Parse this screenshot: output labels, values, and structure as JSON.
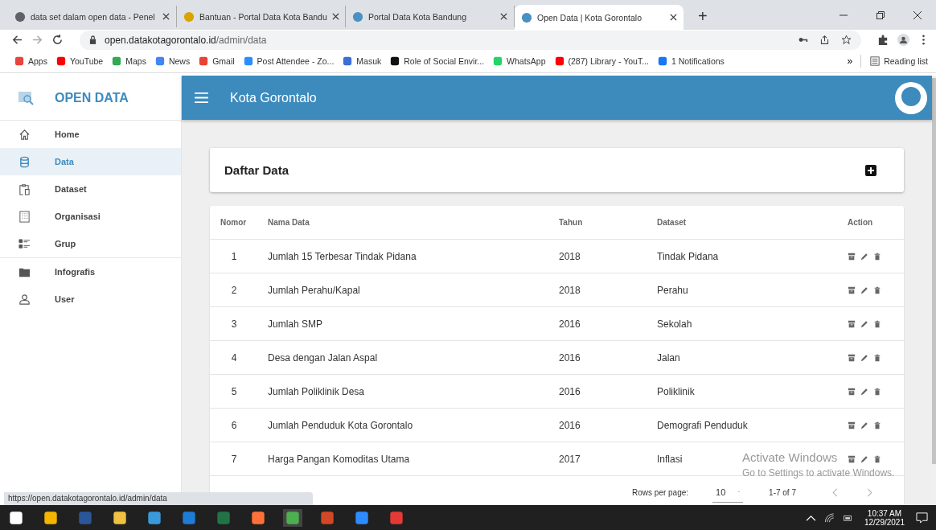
{
  "browser": {
    "tabs": [
      {
        "title": "data set dalam open data - Penel",
        "selected": false
      },
      {
        "title": "Bantuan - Portal Data Kota Bandu",
        "selected": false
      },
      {
        "title": "Portal Data Kota Bandung",
        "selected": false
      },
      {
        "title": "Open Data | Kota Gorontalo",
        "selected": true
      }
    ],
    "new_tab": "+",
    "url_host": "open.datakotagorontalo.id",
    "url_path": "/admin/data",
    "bookmarks": [
      {
        "label": "Apps"
      },
      {
        "label": "YouTube"
      },
      {
        "label": "Maps"
      },
      {
        "label": "News"
      },
      {
        "label": "Gmail"
      },
      {
        "label": "Post Attendee - Zo..."
      },
      {
        "label": "Masuk"
      },
      {
        "label": "Role of Social Envir..."
      },
      {
        "label": "WhatsApp"
      },
      {
        "label": "(287) Library - YouT..."
      },
      {
        "label": "1 Notifications"
      }
    ],
    "overflow": "»",
    "reading_list": "Reading list"
  },
  "sidebar": {
    "brand": "OPEN DATA",
    "items": [
      {
        "label": "Home",
        "selected": false
      },
      {
        "label": "Data",
        "selected": true
      },
      {
        "label": "Dataset",
        "selected": false
      },
      {
        "label": "Organisasi",
        "selected": false
      },
      {
        "label": "Grup",
        "selected": false
      },
      {
        "label": "Infografis",
        "selected": false
      },
      {
        "label": "User",
        "selected": false
      }
    ]
  },
  "header": {
    "title": "Kota Gorontalo"
  },
  "card": {
    "title": "Daftar Data"
  },
  "table": {
    "columns": [
      "Nomor",
      "Nama Data",
      "Tahun",
      "Dataset",
      "Action"
    ],
    "rows": [
      [
        "1",
        "Jumlah 15 Terbesar Tindak Pidana",
        "2018",
        "Tindak Pidana"
      ],
      [
        "2",
        "Jumlah Perahu/Kapal",
        "2018",
        "Perahu"
      ],
      [
        "3",
        "Jumlah SMP",
        "2016",
        "Sekolah"
      ],
      [
        "4",
        "Desa dengan Jalan Aspal",
        "2016",
        "Jalan"
      ],
      [
        "5",
        "Jumlah Poliklinik Desa",
        "2016",
        "Poliklinik"
      ],
      [
        "6",
        "Jumlah Penduduk Kota Gorontalo",
        "2016",
        "Demografi Penduduk"
      ],
      [
        "7",
        "Harga Pangan Komoditas Utama",
        "2017",
        "Inflasi"
      ]
    ]
  },
  "pagination": {
    "label": "Rows per page:",
    "rows_per_page": "10",
    "range": "1-7 of 7"
  },
  "status_url": "https://open.datakotagorontalo.id/admin/data",
  "watermark": {
    "title": "Activate Windows",
    "text": "Go to Settings to activate Windows."
  },
  "taskbar": {
    "time": "10:37 AM",
    "date": "12/29/2021"
  }
}
